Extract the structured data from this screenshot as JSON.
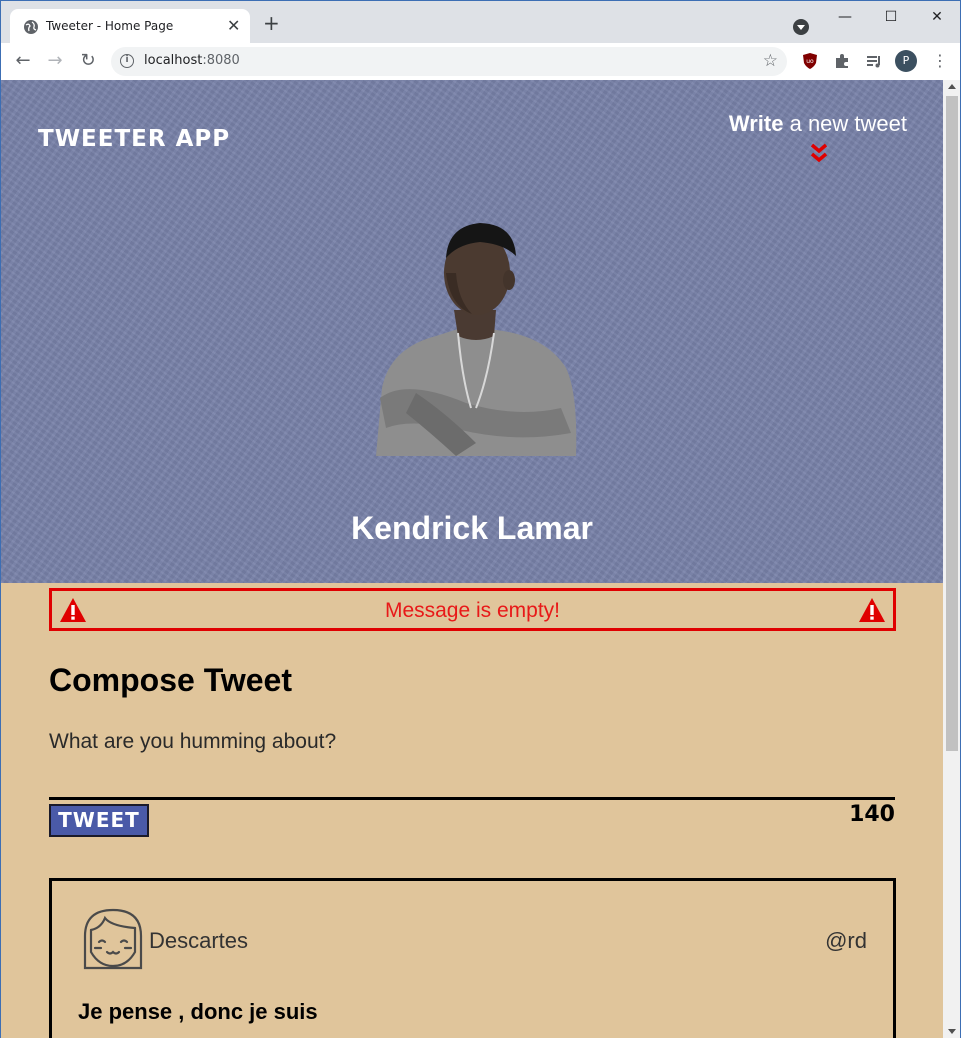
{
  "browser": {
    "tab_title": "Tweeter - Home Page",
    "tab_close": "✕",
    "new_tab": "+",
    "url_host": "localhost",
    "url_port": ":8080",
    "profile_initial": "P",
    "window_controls": {
      "minimize": "—",
      "maximize": "☐",
      "close": "✕"
    }
  },
  "header": {
    "brand": "Tweeter App",
    "write_bold": "Write",
    "write_rest": " a new tweet"
  },
  "profile": {
    "name": "Kendrick Lamar"
  },
  "error": {
    "message": "Message is empty!"
  },
  "compose": {
    "title": "Compose Tweet",
    "placeholder": "What are you humming about?",
    "button_label": "Tweet",
    "counter": "140"
  },
  "tweets": [
    {
      "name": "Descartes",
      "handle": "@rd",
      "text": "Je pense , donc je suis"
    }
  ],
  "colors": {
    "hero_bg": "#7982a9",
    "page_bg": "#e0c59b",
    "error": "#e00000",
    "button_bg": "#4a5aa8",
    "chevron": "#e00000"
  },
  "icons": [
    "globe-icon",
    "back-icon",
    "forward-icon",
    "reload-icon",
    "info-icon",
    "star-icon",
    "ublock-icon",
    "extensions-icon",
    "media-icon",
    "menu-icon",
    "chevron-double-down-icon",
    "warning-icon",
    "avatar-icon"
  ]
}
